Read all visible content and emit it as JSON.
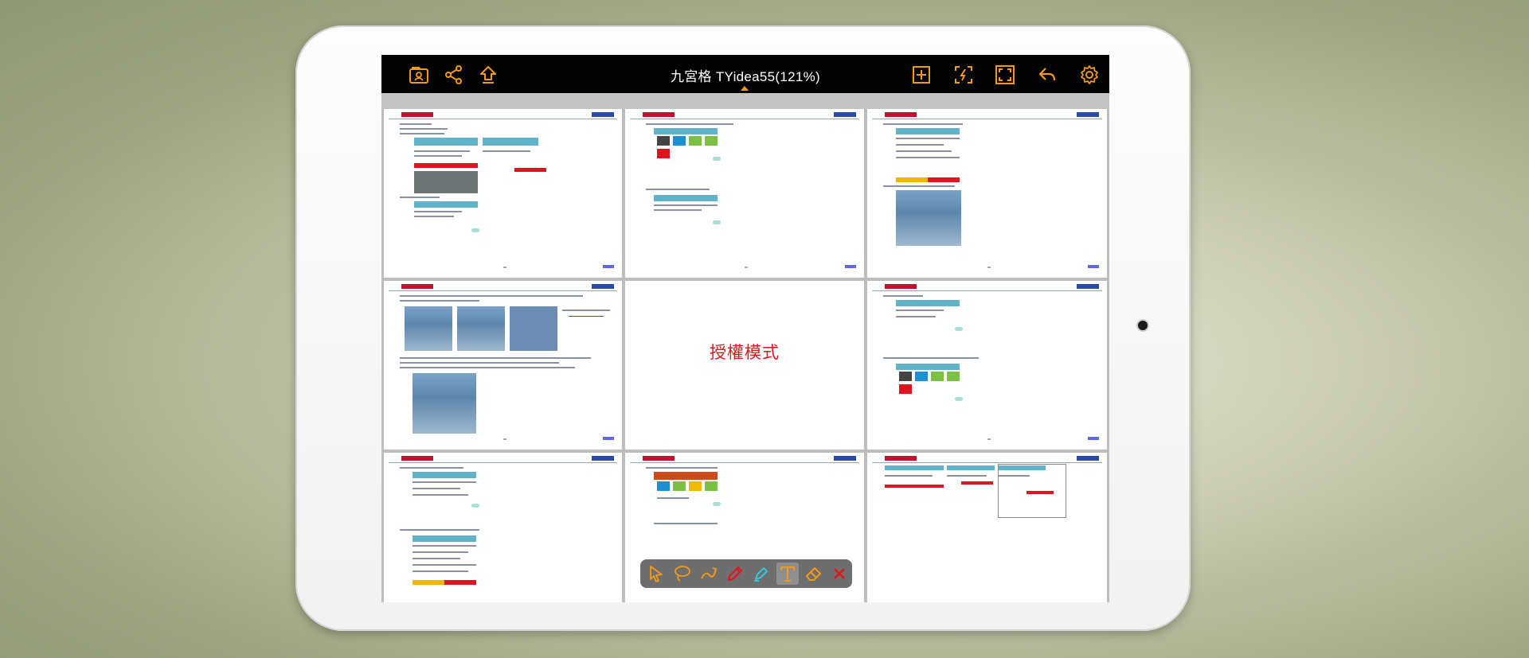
{
  "app": {
    "title": "九宮格 TYidea55(121%)",
    "accent_color": "#f19a1b"
  },
  "toolbar_left": [
    {
      "name": "contacts-icon"
    },
    {
      "name": "share-icon"
    },
    {
      "name": "upload-icon"
    }
  ],
  "toolbar_right": [
    {
      "name": "add-page-icon"
    },
    {
      "name": "sign-icon"
    },
    {
      "name": "fullscreen-icon"
    },
    {
      "name": "undo-icon"
    },
    {
      "name": "settings-icon"
    }
  ],
  "grid": {
    "center_cell_text": "授權模式"
  },
  "annotation_tools": [
    {
      "name": "pointer-icon",
      "color": "#f19a1b"
    },
    {
      "name": "lasso-icon",
      "color": "#f19a1b"
    },
    {
      "name": "curve-pen-icon",
      "color": "#f19a1b"
    },
    {
      "name": "pencil-icon",
      "color": "#e3141c"
    },
    {
      "name": "highlighter-icon",
      "color": "#32c6d8"
    },
    {
      "name": "text-tool-icon",
      "color": "#f19a1b",
      "active": true
    },
    {
      "name": "eraser-icon",
      "color": "#f19a1b"
    },
    {
      "name": "close-icon",
      "color": "#e3141c"
    }
  ]
}
